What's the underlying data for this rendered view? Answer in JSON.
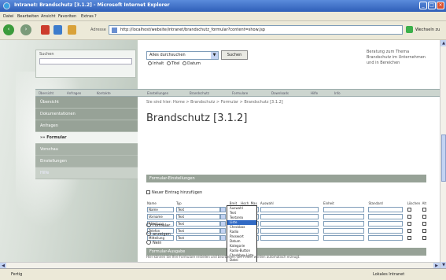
{
  "window": {
    "title": "Intranet: Brandschutz [3.1.2] - Microsoft Internet Explorer",
    "min": "_",
    "max": "□",
    "close": "×"
  },
  "menu": [
    "Datei",
    "Bearbeiten",
    "Ansicht",
    "Favoriten",
    "Extras",
    "?"
  ],
  "toolbar": {
    "back": "‹",
    "forward": "›",
    "address_label": "Adresse",
    "go_label": "Wechseln zu"
  },
  "address": "http://localhost/website/intranet/brandschutz_formular?content=show.jsp",
  "login": {
    "label": "Suchen"
  },
  "search": {
    "select_value": "Alles durchsuchen",
    "button": "Suchen",
    "radio_options": [
      "Inhalt",
      "Titel",
      "Datum"
    ]
  },
  "info_text": "Beratung zum Thema Brandschutz im Unternehmen und in Bereichen",
  "tabs": [
    "Übersicht",
    "Anfragen",
    "Kontakte",
    "Einstellungen",
    "Brandschutz",
    "Formulare",
    "Downloads",
    "Hilfe",
    "Info"
  ],
  "sidebar": [
    {
      "label": "Übersicht",
      "style": ""
    },
    {
      "label": "Dokumentationen",
      "style": ""
    },
    {
      "label": "Anfragen",
      "style": ""
    },
    {
      "label": "»» Formular",
      "style": "active"
    },
    {
      "label": "Vorschau",
      "style": "sub"
    },
    {
      "label": "Einstellungen",
      "style": "sub"
    },
    {
      "label": "Hilfe",
      "style": "light"
    }
  ],
  "content": {
    "breadcrumb": "Sie sind hier:  Home > Brandschutz > Formular > Brandschutz [3.1.2]",
    "title": "Brandschutz [3.1.2]",
    "section1": "Formular-Einstellungen",
    "checkbox_label": "Neuer Eintrag hinzufügen",
    "table_headers": [
      "Name",
      "Typ",
      "Breit",
      "Hoch",
      "Max",
      "Auswahl",
      "Einheit",
      "Standard",
      "Löschen",
      "Alt"
    ],
    "rows": [
      {
        "name": "Name",
        "typ": "Text",
        "breit": "20",
        "hoch": "1",
        "max": "50"
      },
      {
        "name": "Vorname",
        "typ": "Text",
        "breit": "20",
        "hoch": "1",
        "max": "50"
      },
      {
        "name": "Abteilung",
        "typ": "Text",
        "breit": "20",
        "hoch": "1",
        "max": "50"
      },
      {
        "name": "Telefon",
        "typ": "Text",
        "breit": "20",
        "hoch": "1",
        "max": "50"
      },
      {
        "name": "Mitteilung",
        "typ": "Text",
        "breit": "20",
        "hoch": "1",
        "max": "50"
      }
    ],
    "section2": "Formular-Ausgabe",
    "output_options": [
      "Formular",
      "anzeigen",
      "Nein"
    ],
    "bottom_text": "Hier können Sie Ihre Formulare erstellen und bearbeiten. Die Felder werden automatisch erzeugt."
  },
  "dropdown_options": [
    "Auswahl",
    "Text",
    "Textarea",
    "Liste",
    "Checkbox",
    "Radio",
    "Passwort",
    "Datum",
    "Kategorie",
    "Radio-Button",
    "Checkbox-Liste",
    "Datei",
    "Hidden"
  ],
  "dropdown_selected": 3,
  "status": {
    "left": "Fertig",
    "right": "Lokales Intranet"
  }
}
